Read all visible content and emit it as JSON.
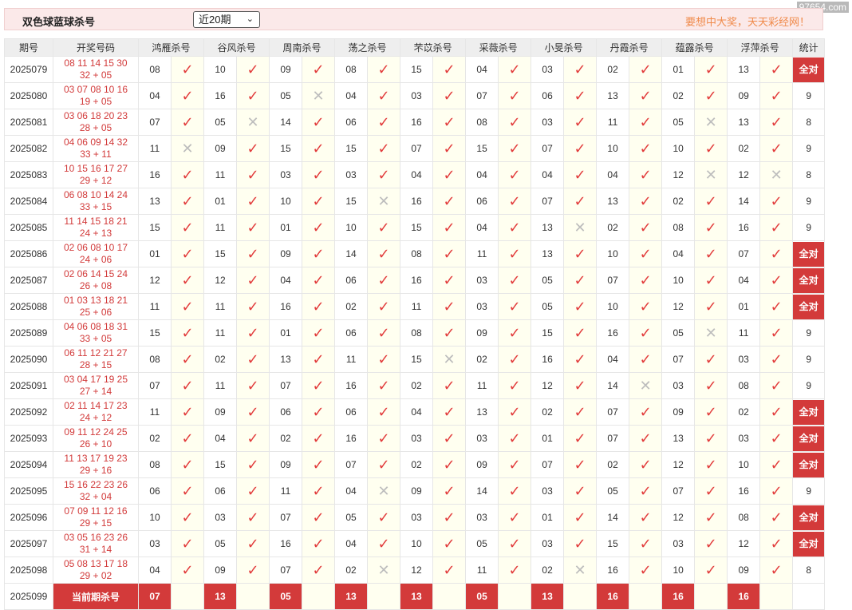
{
  "watermark": "97654.com",
  "header": {
    "title": "双色球蓝球杀号",
    "select_value": "近20期",
    "slogan": "要想中大奖，天天彩经网！"
  },
  "columns": {
    "period": "期号",
    "draw": "开奖号码",
    "experts": [
      "鸿雁杀号",
      "谷风杀号",
      "周南杀号",
      "荡之杀号",
      "芣苡杀号",
      "采薇杀号",
      "小旻杀号",
      "丹霞杀号",
      "蕴露杀号",
      "浮萍杀号"
    ],
    "stat": "统计"
  },
  "rows": [
    {
      "period": "2025079",
      "reds": "08 11 14 15 30",
      "blue": "32 + 05",
      "kills": [
        "08",
        "10",
        "09",
        "08",
        "15",
        "04",
        "03",
        "02",
        "01",
        "13"
      ],
      "hits": [
        1,
        1,
        1,
        1,
        1,
        1,
        1,
        1,
        1,
        1
      ],
      "stat": "全对"
    },
    {
      "period": "2025080",
      "reds": "03 07 08 10 16",
      "blue": "19 + 05",
      "kills": [
        "04",
        "16",
        "05",
        "04",
        "03",
        "07",
        "06",
        "13",
        "02",
        "09"
      ],
      "hits": [
        1,
        1,
        0,
        1,
        1,
        1,
        1,
        1,
        1,
        1
      ],
      "stat": "9"
    },
    {
      "period": "2025081",
      "reds": "03 06 18 20 23",
      "blue": "28 + 05",
      "kills": [
        "07",
        "05",
        "14",
        "06",
        "16",
        "08",
        "03",
        "11",
        "05",
        "13"
      ],
      "hits": [
        1,
        0,
        1,
        1,
        1,
        1,
        1,
        1,
        0,
        1
      ],
      "stat": "8"
    },
    {
      "period": "2025082",
      "reds": "04 06 09 14 32",
      "blue": "33 + 11",
      "kills": [
        "11",
        "09",
        "15",
        "15",
        "07",
        "15",
        "07",
        "10",
        "10",
        "02"
      ],
      "hits": [
        0,
        1,
        1,
        1,
        1,
        1,
        1,
        1,
        1,
        1
      ],
      "stat": "9"
    },
    {
      "period": "2025083",
      "reds": "10 15 16 17 27",
      "blue": "29 + 12",
      "kills": [
        "16",
        "11",
        "03",
        "03",
        "04",
        "04",
        "04",
        "04",
        "12",
        "12"
      ],
      "hits": [
        1,
        1,
        1,
        1,
        1,
        1,
        1,
        1,
        0,
        0
      ],
      "stat": "8"
    },
    {
      "period": "2025084",
      "reds": "06 08 10 14 24",
      "blue": "33 + 15",
      "kills": [
        "13",
        "01",
        "10",
        "15",
        "16",
        "06",
        "07",
        "13",
        "02",
        "14"
      ],
      "hits": [
        1,
        1,
        1,
        0,
        1,
        1,
        1,
        1,
        1,
        1
      ],
      "stat": "9"
    },
    {
      "period": "2025085",
      "reds": "11 14 15 18 21",
      "blue": "24 + 13",
      "kills": [
        "15",
        "11",
        "01",
        "10",
        "15",
        "04",
        "13",
        "02",
        "08",
        "16"
      ],
      "hits": [
        1,
        1,
        1,
        1,
        1,
        1,
        0,
        1,
        1,
        1
      ],
      "stat": "9"
    },
    {
      "period": "2025086",
      "reds": "02 06 08 10 17",
      "blue": "24 + 06",
      "kills": [
        "01",
        "15",
        "09",
        "14",
        "08",
        "11",
        "13",
        "10",
        "04",
        "07"
      ],
      "hits": [
        1,
        1,
        1,
        1,
        1,
        1,
        1,
        1,
        1,
        1
      ],
      "stat": "全对"
    },
    {
      "period": "2025087",
      "reds": "02 06 14 15 24",
      "blue": "26 + 08",
      "kills": [
        "12",
        "12",
        "04",
        "06",
        "16",
        "03",
        "05",
        "07",
        "10",
        "04"
      ],
      "hits": [
        1,
        1,
        1,
        1,
        1,
        1,
        1,
        1,
        1,
        1
      ],
      "stat": "全对"
    },
    {
      "period": "2025088",
      "reds": "01 03 13 18 21",
      "blue": "25 + 06",
      "kills": [
        "11",
        "11",
        "16",
        "02",
        "11",
        "03",
        "05",
        "10",
        "12",
        "01"
      ],
      "hits": [
        1,
        1,
        1,
        1,
        1,
        1,
        1,
        1,
        1,
        1
      ],
      "stat": "全对"
    },
    {
      "period": "2025089",
      "reds": "04 06 08 18 31",
      "blue": "33 + 05",
      "kills": [
        "15",
        "11",
        "01",
        "06",
        "08",
        "09",
        "15",
        "16",
        "05",
        "11"
      ],
      "hits": [
        1,
        1,
        1,
        1,
        1,
        1,
        1,
        1,
        0,
        1
      ],
      "stat": "9"
    },
    {
      "period": "2025090",
      "reds": "06 11 12 21 27",
      "blue": "28 + 15",
      "kills": [
        "08",
        "02",
        "13",
        "11",
        "15",
        "02",
        "16",
        "04",
        "07",
        "03"
      ],
      "hits": [
        1,
        1,
        1,
        1,
        0,
        1,
        1,
        1,
        1,
        1
      ],
      "stat": "9"
    },
    {
      "period": "2025091",
      "reds": "03 04 17 19 25",
      "blue": "27 + 14",
      "kills": [
        "07",
        "11",
        "07",
        "16",
        "02",
        "11",
        "12",
        "14",
        "03",
        "08"
      ],
      "hits": [
        1,
        1,
        1,
        1,
        1,
        1,
        1,
        0,
        1,
        1
      ],
      "stat": "9"
    },
    {
      "period": "2025092",
      "reds": "02 11 14 17 23",
      "blue": "24 + 12",
      "kills": [
        "11",
        "09",
        "06",
        "06",
        "04",
        "13",
        "02",
        "07",
        "09",
        "02"
      ],
      "hits": [
        1,
        1,
        1,
        1,
        1,
        1,
        1,
        1,
        1,
        1
      ],
      "stat": "全对"
    },
    {
      "period": "2025093",
      "reds": "09 11 12 24 25",
      "blue": "26 + 10",
      "kills": [
        "02",
        "04",
        "02",
        "16",
        "03",
        "03",
        "01",
        "07",
        "13",
        "03"
      ],
      "hits": [
        1,
        1,
        1,
        1,
        1,
        1,
        1,
        1,
        1,
        1
      ],
      "stat": "全对"
    },
    {
      "period": "2025094",
      "reds": "11 13 17 19 23",
      "blue": "29 + 16",
      "kills": [
        "08",
        "15",
        "09",
        "07",
        "02",
        "09",
        "07",
        "02",
        "12",
        "10"
      ],
      "hits": [
        1,
        1,
        1,
        1,
        1,
        1,
        1,
        1,
        1,
        1
      ],
      "stat": "全对"
    },
    {
      "period": "2025095",
      "reds": "15 16 22 23 26",
      "blue": "32 + 04",
      "kills": [
        "06",
        "06",
        "11",
        "04",
        "09",
        "14",
        "03",
        "05",
        "07",
        "16"
      ],
      "hits": [
        1,
        1,
        1,
        0,
        1,
        1,
        1,
        1,
        1,
        1
      ],
      "stat": "9"
    },
    {
      "period": "2025096",
      "reds": "07 09 11 12 16",
      "blue": "29 + 15",
      "kills": [
        "10",
        "03",
        "07",
        "05",
        "03",
        "03",
        "01",
        "14",
        "12",
        "08"
      ],
      "hits": [
        1,
        1,
        1,
        1,
        1,
        1,
        1,
        1,
        1,
        1
      ],
      "stat": "全对"
    },
    {
      "period": "2025097",
      "reds": "03 05 16 23 26",
      "blue": "31 + 14",
      "kills": [
        "03",
        "05",
        "16",
        "04",
        "10",
        "05",
        "03",
        "15",
        "03",
        "12"
      ],
      "hits": [
        1,
        1,
        1,
        1,
        1,
        1,
        1,
        1,
        1,
        1
      ],
      "stat": "全对"
    },
    {
      "period": "2025098",
      "reds": "05 08 13 17 18",
      "blue": "29 + 02",
      "kills": [
        "04",
        "09",
        "07",
        "02",
        "12",
        "11",
        "02",
        "16",
        "10",
        "09"
      ],
      "hits": [
        1,
        1,
        1,
        0,
        1,
        1,
        0,
        1,
        1,
        1
      ],
      "stat": "8"
    }
  ],
  "current": {
    "period": "2025099",
    "label": "当前期杀号",
    "kills": [
      "07",
      "13",
      "05",
      "13",
      "13",
      "05",
      "13",
      "16",
      "16",
      "16"
    ]
  },
  "icons": {
    "hit": "check-icon",
    "miss": "cross-icon"
  },
  "colors": {
    "accent": "#d33a3a",
    "mark_bg": "#fffff0",
    "header_bg": "#fbe9e9",
    "slogan": "#f08a4a"
  }
}
